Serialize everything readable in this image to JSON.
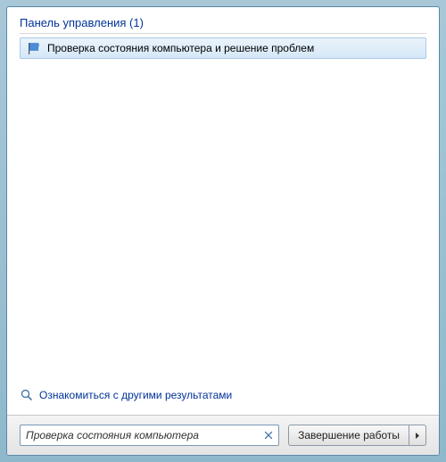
{
  "section": {
    "title": "Панель управления (1)",
    "result_label": "Проверка состояния компьютера и решение проблем"
  },
  "more_results_label": "Ознакомиться с другими результатами",
  "search": {
    "value": "Проверка состояния компьютера"
  },
  "shutdown": {
    "label": "Завершение работы"
  },
  "icons": {
    "flag": "flag-icon",
    "magnifier": "magnifier-icon",
    "clear": "clear-icon",
    "arrow": "arrow-right-icon"
  }
}
